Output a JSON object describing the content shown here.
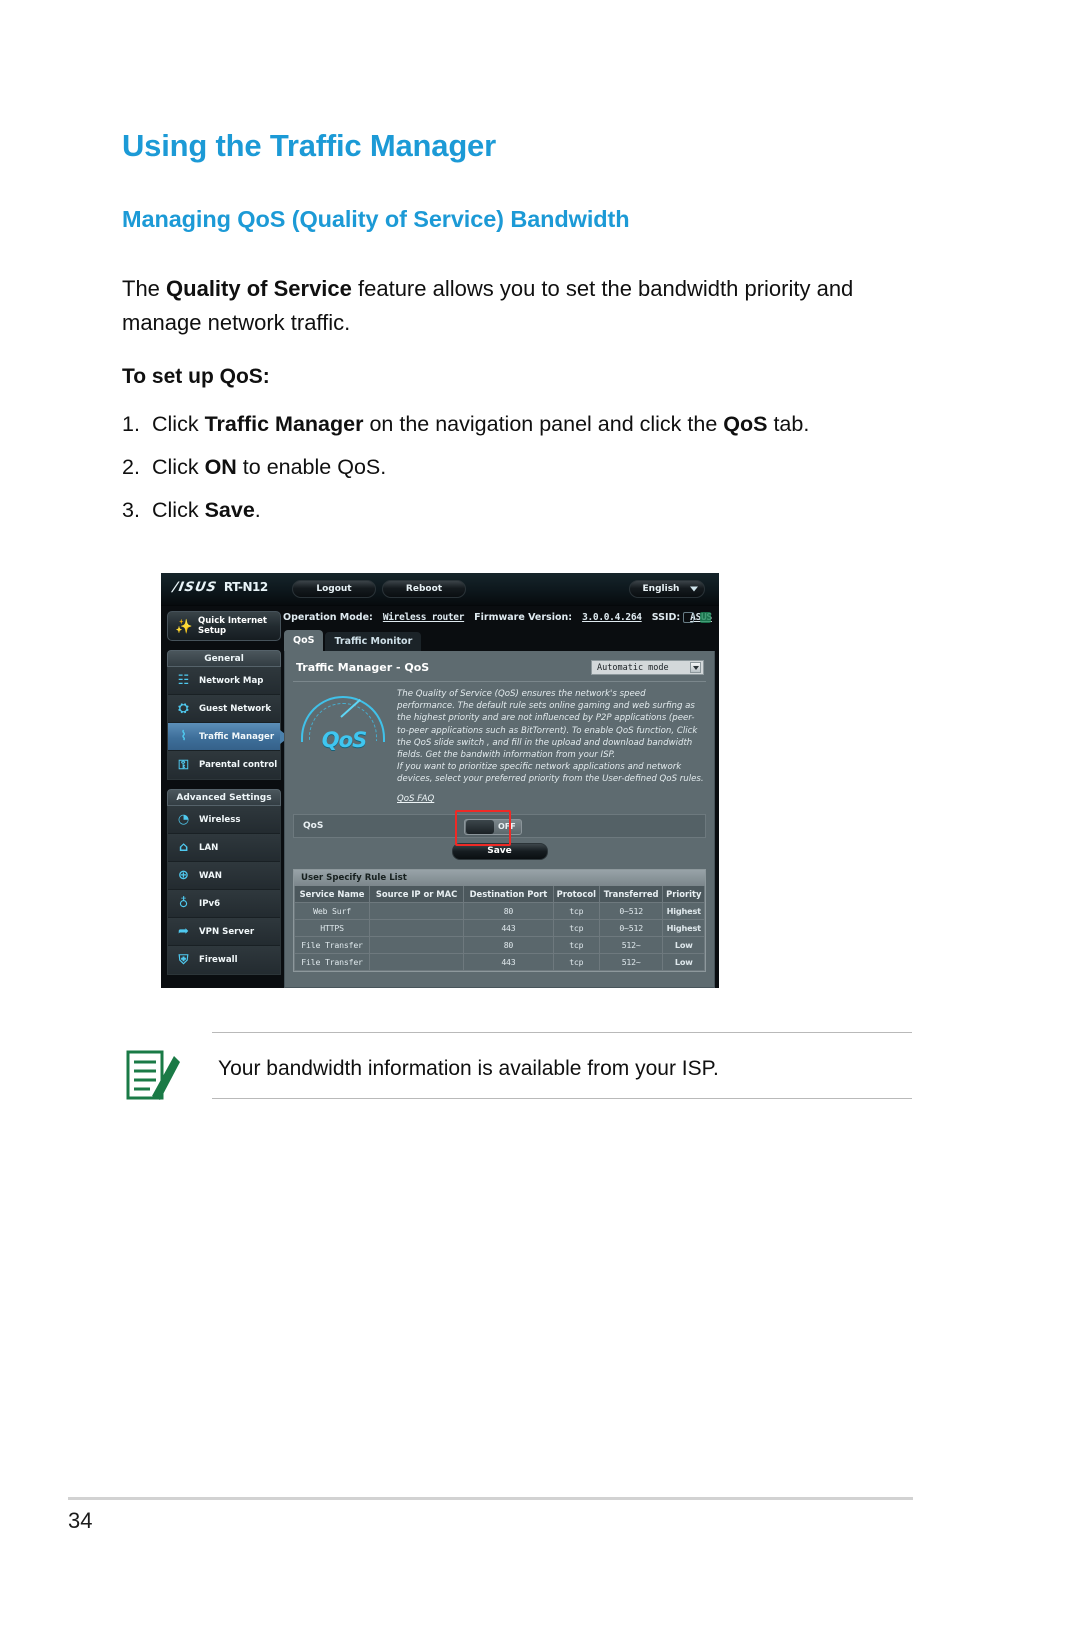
{
  "document": {
    "heading": "Using the Traffic Manager",
    "subheading": "Managing QoS (Quality of Service) Bandwidth",
    "intro_before": "The ",
    "intro_bold": "Quality of Service",
    "intro_after": " feature allows you to set the bandwidth priority and manage network traffic.",
    "steps_title": "To set up QoS:",
    "steps": [
      {
        "num": "1.",
        "parts": [
          {
            "t": "Click ",
            "b": false
          },
          {
            "t": "Traffic Manager",
            "b": true
          },
          {
            "t": " on the navigation panel and click the ",
            "b": false
          },
          {
            "t": "QoS",
            "b": true
          },
          {
            "t": " tab.",
            "b": false
          }
        ]
      },
      {
        "num": "2.",
        "parts": [
          {
            "t": "Click ",
            "b": false
          },
          {
            "t": "ON",
            "b": true
          },
          {
            "t": " to enable QoS.",
            "b": false
          }
        ]
      },
      {
        "num": "3.",
        "parts": [
          {
            "t": "Click ",
            "b": false
          },
          {
            "t": "Save",
            "b": true
          },
          {
            "t": ".",
            "b": false
          }
        ]
      }
    ],
    "note_text": "Your bandwidth information is available from your ISP.",
    "note_icon": "note-pencil-icon",
    "page_number": "34",
    "accent_color": "#1c9ad6"
  },
  "router_ui": {
    "header": {
      "brand": "/ISUS",
      "model": "RT-N12",
      "logout_label": "Logout",
      "reboot_label": "Reboot",
      "language_label": "English",
      "language_chevron": "chevron-down-icon"
    },
    "info_bar": {
      "operation_mode_label": "Operation Mode:",
      "operation_mode_value": "Wireless router",
      "firmware_label": "Firmware Version:",
      "firmware_value": "3.0.0.4.264",
      "ssid_label": "SSID:",
      "ssid_value": "ASUS",
      "usb_icon": "usb-icon",
      "printer_icon": "printer-icon"
    },
    "sidebar": {
      "quick_setup": {
        "label": "Quick Internet Setup",
        "icon": "magic-wand-icon"
      },
      "groups": [
        {
          "title": "General",
          "items": [
            {
              "label": "Network Map",
              "icon": "network-map-icon",
              "active": false,
              "glyph": "☷"
            },
            {
              "label": "Guest Network",
              "icon": "guest-network-icon",
              "active": false,
              "glyph": "⛭"
            },
            {
              "label": "Traffic Manager",
              "icon": "traffic-manager-icon",
              "active": true,
              "glyph": "⌇"
            },
            {
              "label": "Parental control",
              "icon": "parental-control-icon",
              "active": false,
              "glyph": "⚿"
            }
          ]
        },
        {
          "title": "Advanced Settings",
          "items": [
            {
              "label": "Wireless",
              "icon": "wireless-icon",
              "active": false,
              "glyph": "◔"
            },
            {
              "label": "LAN",
              "icon": "lan-home-icon",
              "active": false,
              "glyph": "⌂"
            },
            {
              "label": "WAN",
              "icon": "wan-globe-icon",
              "active": false,
              "glyph": "⊕"
            },
            {
              "label": "IPv6",
              "icon": "ipv6-globe-icon",
              "active": false,
              "glyph": "♁"
            },
            {
              "label": "VPN Server",
              "icon": "vpn-server-icon",
              "active": false,
              "glyph": "➦"
            },
            {
              "label": "Firewall",
              "icon": "firewall-shield-icon",
              "active": false,
              "glyph": "⛨"
            }
          ]
        }
      ]
    },
    "tabs": [
      {
        "label": "QoS",
        "active": true
      },
      {
        "label": "Traffic Monitor",
        "active": false
      }
    ],
    "panel": {
      "title": "Traffic Manager - QoS",
      "mode_value": "Automatic mode",
      "mode_chevron": "chevron-down-icon",
      "logo_text": "QoS",
      "logo_icon": "qos-gauge-icon",
      "description": "The Quality of Service (QoS) ensures the network's speed performance. The default rule sets online gaming and web surfing as the highest priority and are not influenced by P2P applications (peer-to-peer applications such as BitTorrent). To enable QoS function, Click the QoS slide switch , and fill in the upload and download bandwidth fields. Get the bandwith information from your ISP.",
      "description2": "If you want to prioritize specific network applications and network devices, select your preferred priority from the User-defined QoS rules.",
      "faq_link": "QoS FAQ",
      "qos_row_label": "QoS",
      "qos_switch_state": "OFF",
      "save_label": "Save",
      "highlight_color": "#ef2a26"
    },
    "rule_list": {
      "title": "User Specify Rule List",
      "columns": [
        "Service Name",
        "Source IP or MAC",
        "Destination Port",
        "Protocol",
        "Transferred",
        "Priority"
      ],
      "rows": [
        {
          "service": "Web Surf",
          "source": "",
          "port": "80",
          "protocol": "tcp",
          "transferred": "0~512",
          "priority": "Highest"
        },
        {
          "service": "HTTPS",
          "source": "",
          "port": "443",
          "protocol": "tcp",
          "transferred": "0~512",
          "priority": "Highest"
        },
        {
          "service": "File Transfer",
          "source": "",
          "port": "80",
          "protocol": "tcp",
          "transferred": "512~",
          "priority": "Low"
        },
        {
          "service": "File Transfer",
          "source": "",
          "port": "443",
          "protocol": "tcp",
          "transferred": "512~",
          "priority": "Low"
        }
      ]
    }
  }
}
